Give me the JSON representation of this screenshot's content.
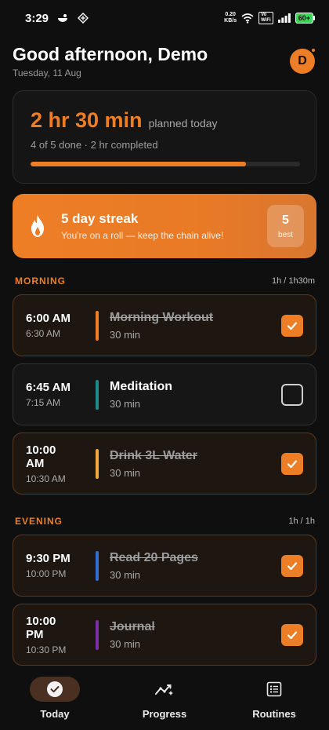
{
  "status_bar": {
    "time": "3:29",
    "net_speed_value": "0.20",
    "net_speed_unit": "KB/s",
    "wifi_tag_top": "Vo",
    "wifi_tag_bottom": "WiFi",
    "battery": "60+"
  },
  "header": {
    "greeting": "Good afternoon, Demo",
    "date": "Tuesday, 11 Aug",
    "avatar_initial": "D"
  },
  "summary": {
    "planned": "2 hr 30 min",
    "planned_suffix": "planned today",
    "subtitle": "4 of 5 done · 2 hr completed",
    "progress_fraction": 0.8
  },
  "streak": {
    "title": "5 day streak",
    "subtitle": "You're on a roll — keep the chain alive!",
    "best_value": "5",
    "best_label": "best"
  },
  "sections": {
    "morning": {
      "title": "MORNING",
      "meta": "1h / 1h30m",
      "tasks": [
        {
          "start": "6:00 AM",
          "end": "6:30 AM",
          "name": "Morning Workout",
          "duration": "30 min",
          "done": true,
          "color": "#ee7e26"
        },
        {
          "start": "6:45 AM",
          "end": "7:15 AM",
          "name": "Meditation",
          "duration": "30 min",
          "done": false,
          "color": "#1f8a8a"
        },
        {
          "start": "10:00 AM",
          "end": "10:30 AM",
          "name": "Drink 3L Water",
          "duration": "30 min",
          "done": true,
          "color": "#f2a93b"
        }
      ]
    },
    "evening": {
      "title": "EVENING",
      "meta": "1h / 1h",
      "tasks": [
        {
          "start": "9:30 PM",
          "end": "10:00 PM",
          "name": "Read 20 Pages",
          "duration": "30 min",
          "done": true,
          "color": "#2f6fd6"
        },
        {
          "start": "10:00 PM",
          "end": "10:30 PM",
          "name": "Journal",
          "duration": "30 min",
          "done": true,
          "color": "#7a2fa8"
        }
      ]
    }
  },
  "nav": {
    "today": "Today",
    "progress": "Progress",
    "routines": "Routines"
  },
  "colors": {
    "accent": "#ee7e26",
    "background": "#0f0f0f"
  }
}
